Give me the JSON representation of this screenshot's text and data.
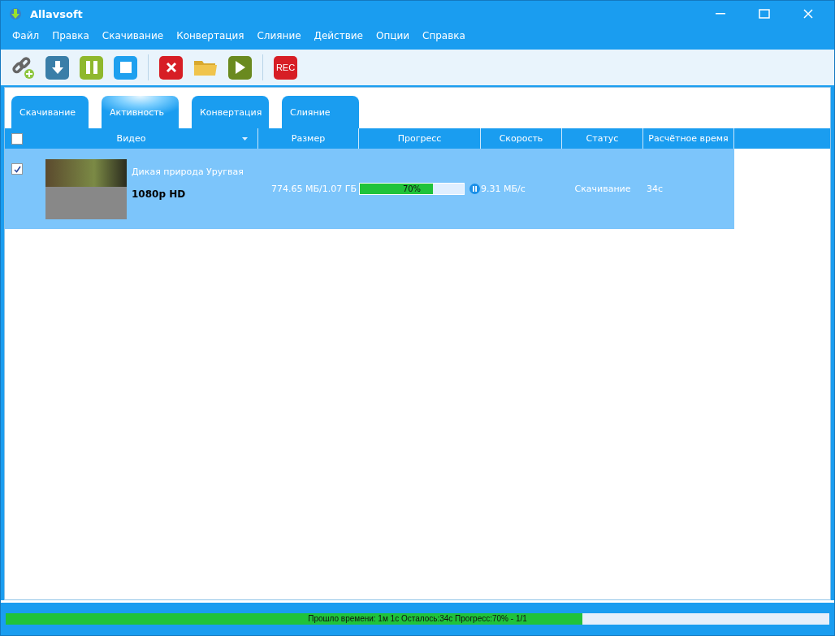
{
  "window": {
    "title": "Allavsoft"
  },
  "menu": [
    "Файл",
    "Правка",
    "Скачивание",
    "Конвертация",
    "Слияние",
    "Действие",
    "Опции",
    "Справка"
  ],
  "toolbar": [
    {
      "kind": "link"
    },
    {
      "kind": "download"
    },
    {
      "kind": "pause"
    },
    {
      "kind": "stop"
    },
    {
      "kind": "separator"
    },
    {
      "kind": "delete"
    },
    {
      "kind": "folder"
    },
    {
      "kind": "play"
    },
    {
      "kind": "separator"
    },
    {
      "kind": "rec",
      "label": "REC"
    }
  ],
  "tabs": [
    {
      "label": "Скачивание",
      "selected": false
    },
    {
      "label": "Активность",
      "selected": true
    },
    {
      "label": "Конвертация",
      "selected": false
    },
    {
      "label": "Слияние",
      "selected": false
    }
  ],
  "table": {
    "select_all": {
      "checked": false
    },
    "columns": [
      "Видео",
      "Размер",
      "Прогресс",
      "Скорость",
      "Статус",
      "Расчётное время"
    ],
    "rows": [
      {
        "checked": true,
        "selected": true,
        "title": "Дикая природа Уругвая",
        "quality": "1080p HD",
        "size": "774.65 МБ/1.07 ГБ",
        "level": 0.7,
        "progress": "70%",
        "speed": "9.31 МБ/с",
        "status": "Скачивание",
        "eta": "34с"
      }
    ]
  },
  "status_bar": {
    "level": 0.7,
    "text": "Прошло времени: 1м  1с Осталось:34с Прогресс:70% - 1/1"
  }
}
